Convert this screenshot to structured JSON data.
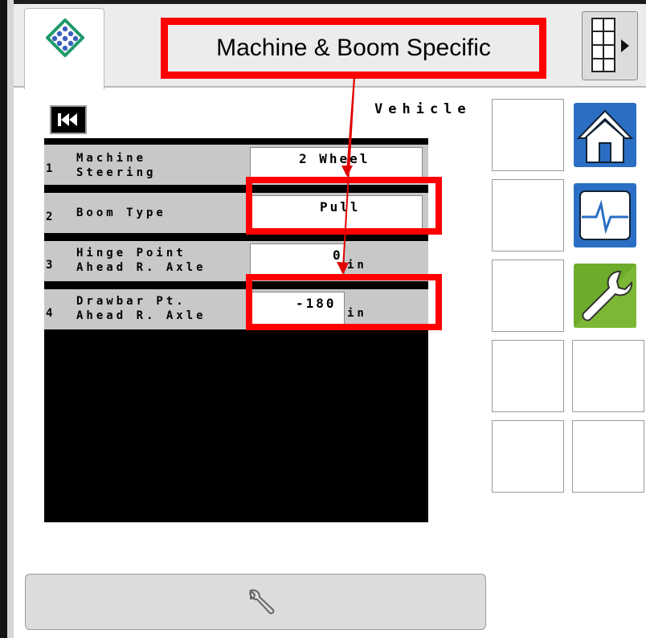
{
  "header": {
    "title": "Machine & Boom Specific",
    "tab_icon": "app-logo-icon",
    "grid_icon": "grid-menu-icon"
  },
  "section": {
    "label": "Vehicle"
  },
  "rows": [
    {
      "num": "1",
      "label": "Machine\nSteering",
      "value": "2 Wheel",
      "unit": ""
    },
    {
      "num": "2",
      "label": "Boom Type",
      "value": "Pull",
      "unit": ""
    },
    {
      "num": "3",
      "label": "Hinge Point\nAhead R. Axle",
      "value": "0",
      "unit": "in"
    },
    {
      "num": "4",
      "label": "Drawbar Pt.\nAhead R. Axle",
      "value": "-180",
      "unit": "in"
    }
  ],
  "side_icons": [
    "home-icon",
    "diagnostics-icon",
    "wrench-icon"
  ],
  "footer": {
    "icon": "wrench-icon"
  },
  "colors": {
    "highlight": "#ff0000",
    "home_blue": "#2b6fc4",
    "wrench_green": "#6dab2a"
  }
}
